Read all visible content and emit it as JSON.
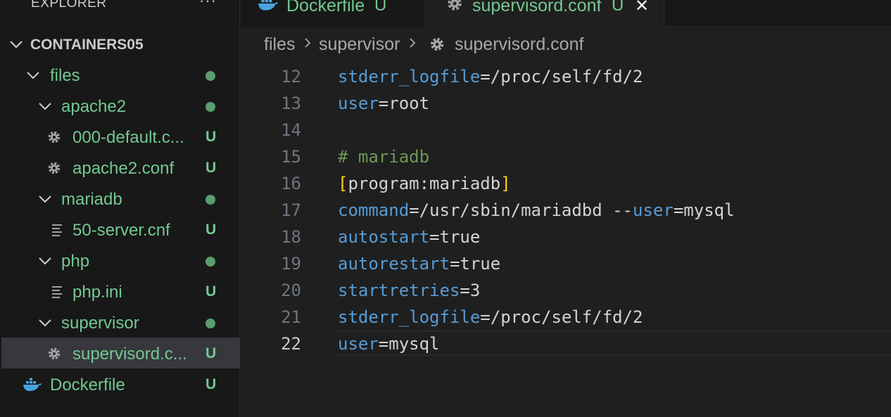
{
  "explorer": {
    "title": "EXPLORER",
    "more_label": "···",
    "tree": [
      {
        "label": "CONTAINERS05",
        "kind": "root",
        "expanded": true
      },
      {
        "label": "files",
        "kind": "folder",
        "expanded": true,
        "status": "modified-dot"
      },
      {
        "label": "apache2",
        "kind": "folder",
        "expanded": true,
        "status": "modified-dot"
      },
      {
        "label": "000-default.c...",
        "kind": "file",
        "icon": "gear-icon",
        "badge": "U"
      },
      {
        "label": "apache2.conf",
        "kind": "file",
        "icon": "gear-icon",
        "badge": "U"
      },
      {
        "label": "mariadb",
        "kind": "folder",
        "expanded": true,
        "status": "modified-dot"
      },
      {
        "label": "50-server.cnf",
        "kind": "file",
        "icon": "lines-icon",
        "badge": "U"
      },
      {
        "label": "php",
        "kind": "folder",
        "expanded": true,
        "status": "modified-dot"
      },
      {
        "label": "php.ini",
        "kind": "file",
        "icon": "lines-icon",
        "badge": "U"
      },
      {
        "label": "supervisor",
        "kind": "folder",
        "expanded": true,
        "status": "modified-dot"
      },
      {
        "label": "supervisord.c...",
        "kind": "file",
        "icon": "gear-icon",
        "badge": "U",
        "selected": true
      },
      {
        "label": "Dockerfile",
        "kind": "file",
        "icon": "docker-icon",
        "badge": "U"
      }
    ]
  },
  "tabs": [
    {
      "label": "Dockerfile",
      "badge": "U",
      "icon": "docker-icon",
      "active": false
    },
    {
      "label": "supervisord.conf",
      "badge": "U",
      "icon": "gear-icon",
      "active": true,
      "close_label": "✕"
    }
  ],
  "breadcrumb": [
    "files",
    "supervisor",
    "supervisord.conf"
  ],
  "editor": {
    "lines": [
      {
        "number": "12",
        "key": "stderr_logfile",
        "eq": "=",
        "value": "/proc/self/fd/2"
      },
      {
        "number": "13",
        "key": "user",
        "eq": "=",
        "value": "root"
      },
      {
        "number": "14"
      },
      {
        "number": "15",
        "comment": "# mariadb"
      },
      {
        "number": "16",
        "bracket_open": "[",
        "section": "program:mariadb",
        "bracket_close": "]"
      },
      {
        "number": "17",
        "key": "command",
        "eq": "=",
        "value": "/usr/sbin/mariadbd --",
        "key2": "user",
        "eq2": "=",
        "value2": "mysql"
      },
      {
        "number": "18",
        "key": "autostart",
        "eq": "=",
        "value": "true"
      },
      {
        "number": "19",
        "key": "autorestart",
        "eq": "=",
        "value": "true"
      },
      {
        "number": "20",
        "key": "startretries",
        "eq": "=",
        "value": "3"
      },
      {
        "number": "21",
        "key": "stderr_logfile",
        "eq": "=",
        "value": "/proc/self/fd/2"
      },
      {
        "number": "22",
        "key": "user",
        "eq": "=",
        "value": "mysql",
        "current": true
      }
    ]
  },
  "colors": {
    "git_untracked": "#73c991",
    "key": "#569cd6",
    "comment": "#6a9955",
    "bracket": "#ffd700",
    "background": "#1f1f1f",
    "sidebar_background": "#181818"
  }
}
